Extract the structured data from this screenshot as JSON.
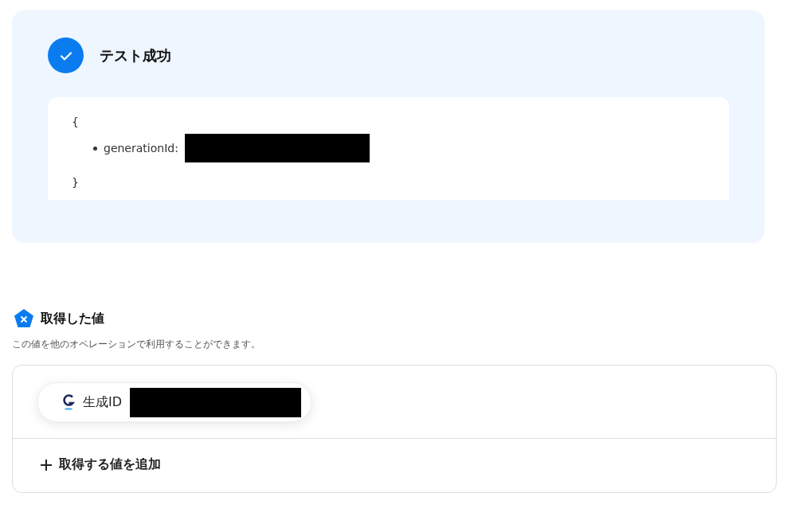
{
  "test_result": {
    "success": true,
    "title": "テスト成功"
  },
  "output": {
    "open_brace": "{",
    "items": [
      {
        "key": "generationId:",
        "redacted": true
      }
    ],
    "close_brace": "}"
  },
  "values": {
    "title": "取得した値",
    "description": "この値を他のオペレーションで利用することができます。",
    "items": [
      {
        "label": "生成ID",
        "redacted": true
      }
    ],
    "add_button": "取得する値を追加"
  }
}
